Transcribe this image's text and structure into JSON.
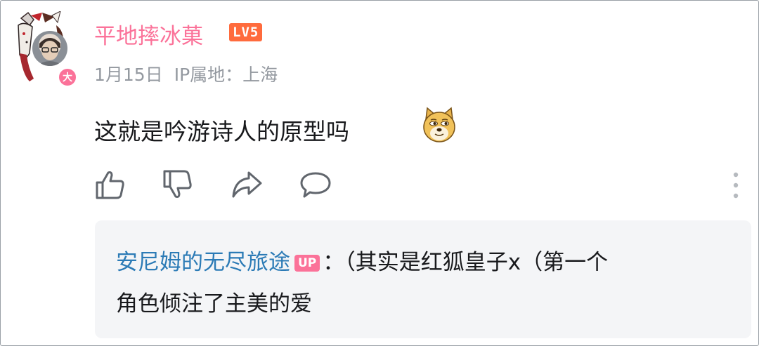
{
  "comment": {
    "username": "平地摔冰菓",
    "level": "LV5",
    "avatar_badge": "大",
    "date": "1月15日",
    "ip_location": "IP属地：上海",
    "text": "这就是吟游诗人的原型吗",
    "emoji": "doge-emoji"
  },
  "actions": {
    "like_icon": "thumbs-up-icon",
    "dislike_icon": "thumbs-down-icon",
    "share_icon": "share-icon",
    "reply_icon": "comment-bubble-icon",
    "more_icon": "more-vertical-icon"
  },
  "reply": {
    "username": "安尼姆的无尽旅途",
    "up_badge": "UP",
    "line1_text": "：（其实是红狐皇子x（第一个",
    "line2_text": "角色倾注了主美的爱"
  },
  "colors": {
    "username": "#fb7299",
    "level_badge": "#ff6b3d",
    "meta_text": "#9499a0",
    "reply_username": "#2c7bb6",
    "reply_bg": "#f4f5f7"
  }
}
